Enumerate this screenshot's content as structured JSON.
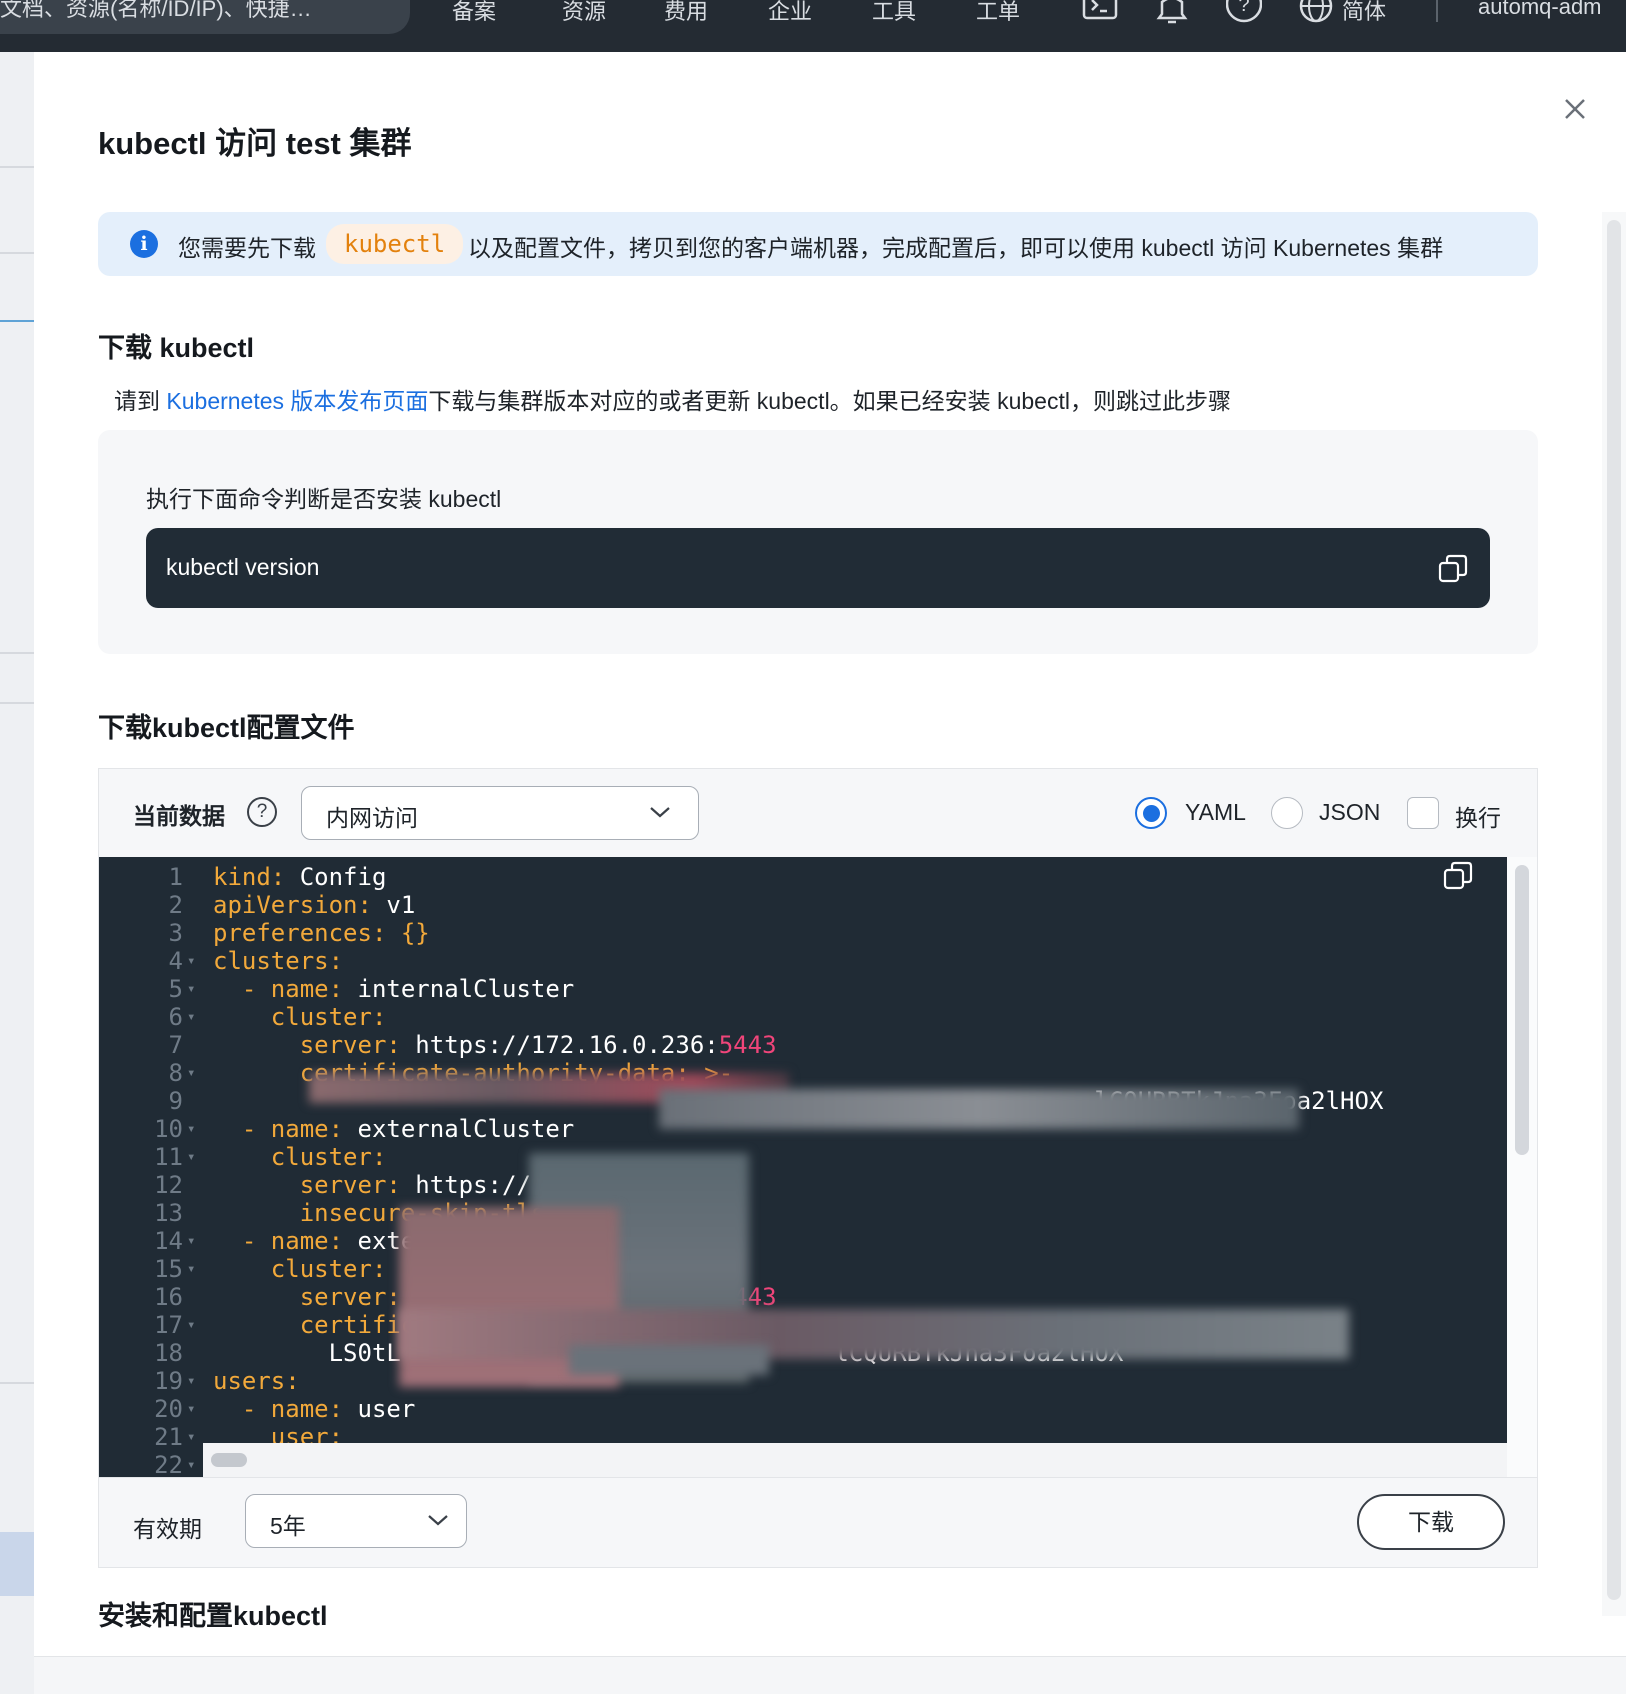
{
  "topnav": {
    "search_text": "文档、资源(名称/ID/IP)、快捷…",
    "items": [
      "备案",
      "资源",
      "费用",
      "企业",
      "工具",
      "工单"
    ],
    "language": "简体",
    "account": "automq-adm",
    "icons": [
      "terminal-icon",
      "bell-icon",
      "help-icon",
      "globe-icon"
    ]
  },
  "modal": {
    "title": "kubectl 访问 test 集群",
    "alert": {
      "prefix": "您需要先下载",
      "code": "kubectl",
      "suffix": "以及配置文件，拷贝到您的客户端机器，完成配置后，即可以使用 kubectl 访问 Kubernetes 集群"
    },
    "section1": {
      "title": "下载 kubectl",
      "para_prefix": "请到 ",
      "para_link": "Kubernetes 版本发布页面",
      "para_suffix": "下载与集群版本对应的或者更新 kubectl。如果已经安装 kubectl，则跳过此步骤",
      "check_label": "执行下面命令判断是否安装 kubectl",
      "command": "kubectl version"
    },
    "section2": {
      "title": "下载kubectl配置文件",
      "data_label": "当前数据",
      "access_select": "内网访问",
      "format_options": [
        "YAML",
        "JSON"
      ],
      "format_selected": "YAML",
      "wrap_label": "换行",
      "wrap_checked": false,
      "validity_label": "有效期",
      "validity_select": "5年",
      "download_button": "下载"
    },
    "section3": {
      "title": "安装和配置kubectl"
    }
  },
  "editor": {
    "line_numbers": [
      "1",
      "2",
      "3",
      "4",
      "5",
      "6",
      "7",
      "8",
      "9",
      "10",
      "11",
      "12",
      "13",
      "14",
      "15",
      "16",
      "17",
      "18",
      "19",
      "20",
      "21",
      "22"
    ],
    "fold_lines": [
      4,
      5,
      6,
      8,
      10,
      11,
      14,
      15,
      17,
      19,
      20,
      21,
      22
    ],
    "lines": [
      [
        [
          "k",
          "kind:"
        ],
        [
          "t",
          " Config"
        ]
      ],
      [
        [
          "k",
          "apiVersion:"
        ],
        [
          "t",
          " v1"
        ]
      ],
      [
        [
          "k",
          "preferences:"
        ],
        [
          "k",
          " {}"
        ]
      ],
      [
        [
          "k",
          "clusters:"
        ]
      ],
      [
        [
          "k",
          "  - name:"
        ],
        [
          "t",
          " internalCluster"
        ]
      ],
      [
        [
          "k",
          "    cluster:"
        ]
      ],
      [
        [
          "k",
          "      server:"
        ],
        [
          "t",
          " https://172.16.0.236:"
        ],
        [
          "n",
          "5443"
        ]
      ],
      [
        [
          "k",
          "      certificate-authority-data: >-"
        ]
      ],
      [
        [
          "t",
          "                                                             lCQURBTkJna3Foa2lHOX"
        ]
      ],
      [
        [
          "k",
          "  - name:"
        ],
        [
          "t",
          " externalCluster"
        ]
      ],
      [
        [
          "k",
          "    cluster:"
        ]
      ],
      [
        [
          "k",
          "      server:"
        ],
        [
          "t",
          " https://      .26:"
        ],
        [
          "n",
          "5443"
        ]
      ],
      [
        [
          "k",
          "      insecure-skip-tls-verify:"
        ],
        [
          "b",
          " true"
        ]
      ],
      [
        [
          "k",
          "  - name:"
        ],
        [
          "t",
          " externalClusterTLSVerify"
        ]
      ],
      [
        [
          "k",
          "    cluster:"
        ]
      ],
      [
        [
          "k",
          "      server:"
        ],
        [
          "t",
          " https://           6:"
        ],
        [
          "n",
          "5443"
        ]
      ],
      [
        [
          "k",
          "      certificate-authority-data: >-"
        ]
      ],
      [
        [
          "t",
          "        LS0tL                              lCQURBTkJna3Foa2lHOX"
        ]
      ],
      [
        [
          "k",
          "users:"
        ]
      ],
      [
        [
          "k",
          "  - name:"
        ],
        [
          "t",
          " user"
        ]
      ],
      [
        [
          "k",
          "    user:"
        ]
      ],
      [
        [
          "t",
          ""
        ]
      ]
    ]
  },
  "colors": {
    "accent": "#1b6fe0",
    "editor_bg": "#202b35",
    "yaml_key": "#f2a93b",
    "yaml_number": "#f0457a",
    "yaml_bool": "#c98bf2"
  }
}
